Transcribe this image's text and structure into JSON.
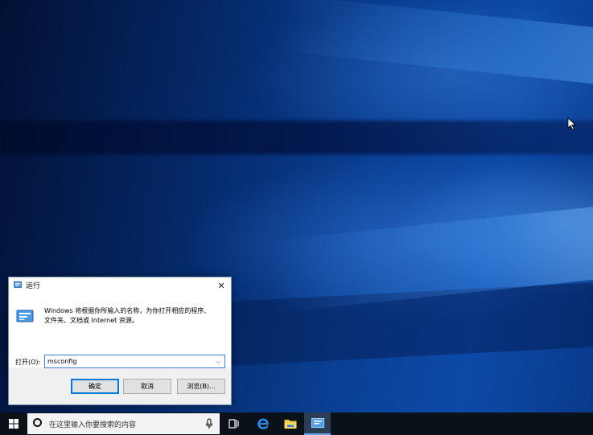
{
  "dialog": {
    "title": "运行",
    "close_glyph": "✕",
    "description_line1": "Windows 将根据你所输入的名称，为你打开相应的程序、",
    "description_line2": "文件夹、文档或 Internet 资源。",
    "open_label": "打开(O):",
    "open_value": "msconfig",
    "dropdown_glyph": "⌵",
    "ok_label": "确定",
    "cancel_label": "取消",
    "browse_label": "浏览(B)..."
  },
  "taskbar": {
    "search_placeholder": "在这里输入你要搜索的内容",
    "icons": [
      "windows-start-icon",
      "search-circle-icon",
      "microphone-icon",
      "task-view-icon",
      "edge-icon",
      "file-explorer-icon",
      "run-icon"
    ]
  },
  "colors": {
    "taskbar_bg": "#0b1118",
    "accent_blue": "#0078d7",
    "dialog_bg": "#f0f0f0"
  }
}
